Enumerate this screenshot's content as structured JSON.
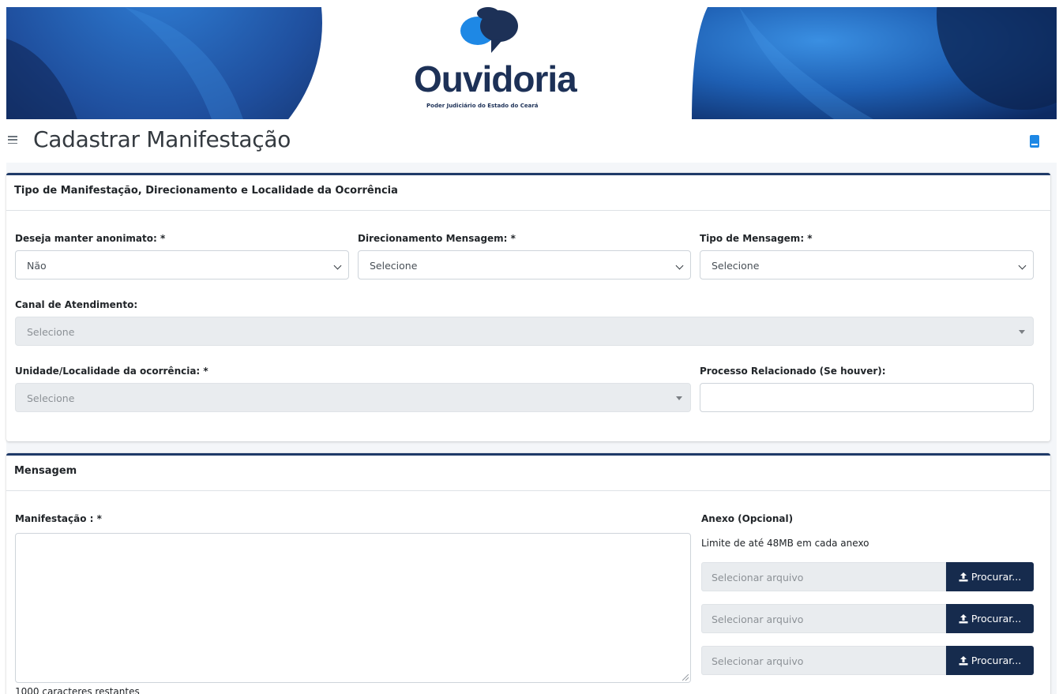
{
  "banner": {
    "logo_title": "Ouvidoria",
    "logo_subtitle": "Poder Judiciário do Estado do Ceará"
  },
  "header": {
    "title": "Cadastrar Manifestação",
    "menu_icon": "hamburger-menu-icon",
    "help_icon": "book-icon"
  },
  "section1": {
    "title": "Tipo de Manifestação, Direcionamento e Localidade da Ocorrência",
    "anonimato": {
      "label": "Deseja manter anonimato: *",
      "value": "Não"
    },
    "direcionamento": {
      "label": "Direcionamento Mensagem: *",
      "value": "Selecione"
    },
    "tipo": {
      "label": "Tipo de Mensagem: *",
      "value": "Selecione"
    },
    "canal": {
      "label": "Canal de Atendimento:",
      "value": "Selecione"
    },
    "unidade": {
      "label": "Unidade/Localidade da ocorrência: *",
      "value": "Selecione"
    },
    "processo": {
      "label": "Processo Relacionado (Se houver):",
      "value": ""
    }
  },
  "section2": {
    "title": "Mensagem",
    "manifestacao": {
      "label": "Manifestação : *",
      "value": ""
    },
    "counter": "1000 caracteres restantes",
    "anexo": {
      "label": "Anexo (Opcional)",
      "limit": "Limite de até 48MB em cada anexo",
      "files": [
        {
          "placeholder": "Selecionar arquivo",
          "button": "Procurar..."
        },
        {
          "placeholder": "Selecionar arquivo",
          "button": "Procurar..."
        },
        {
          "placeholder": "Selecionar arquivo",
          "button": "Procurar..."
        }
      ]
    }
  },
  "colors": {
    "primary_dark": "#162b4d",
    "card_border": "#1f3a68",
    "logo_blue": "#1e88e5"
  }
}
